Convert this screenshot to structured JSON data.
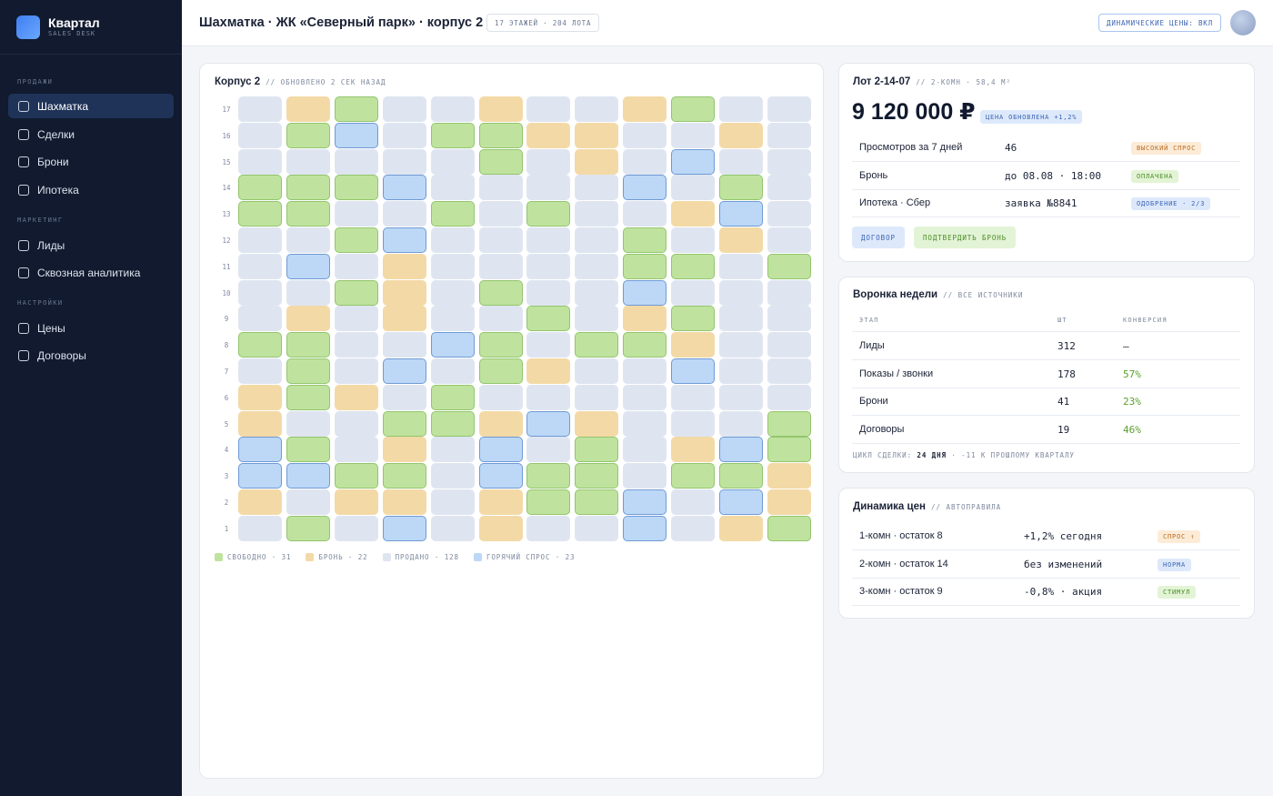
{
  "app": {
    "name": "Квартал",
    "subtitle": "SALES DESK"
  },
  "sidebar": {
    "sections": [
      {
        "label": "ПРОДАЖИ",
        "items": [
          {
            "label": "Шахматка",
            "active": true
          },
          {
            "label": "Сделки"
          },
          {
            "label": "Брони"
          },
          {
            "label": "Ипотека"
          }
        ]
      },
      {
        "label": "МАРКЕТИНГ",
        "items": [
          {
            "label": "Лиды"
          },
          {
            "label": "Сквозная аналитика"
          }
        ]
      },
      {
        "label": "НАСТРОЙКИ",
        "items": [
          {
            "label": "Цены"
          },
          {
            "label": "Договоры"
          }
        ]
      }
    ]
  },
  "header": {
    "title": "Шахматка · ЖК «Северный парк» · корпус 2",
    "stats_pill": "17 ЭТАЖЕЙ · 204 ЛОТА",
    "dynamic_pill": "ДИНАМИЧЕСКИЕ ЦЕНЫ: ВКЛ"
  },
  "board": {
    "title": "Корпус 2",
    "subtitle": "// ОБНОВЛЕНО 2 СЕК НАЗАД",
    "floors": [
      "17",
      "16",
      "15",
      "14",
      "13",
      "12",
      "11",
      "10",
      "9",
      "8",
      "7",
      "6",
      "5",
      "4",
      "3",
      "2",
      "1"
    ],
    "grid": [
      [
        "S",
        "R",
        "F",
        "S",
        "S",
        "R",
        "S",
        "S",
        "R",
        "F",
        "S",
        "S"
      ],
      [
        "S",
        "F",
        "H",
        "S",
        "F",
        "F",
        "R",
        "R",
        "S",
        "S",
        "R",
        "S"
      ],
      [
        "S",
        "S",
        "S",
        "S",
        "S",
        "F",
        "S",
        "R",
        "S",
        "H",
        "S",
        "S"
      ],
      [
        "F",
        "F",
        "F",
        "H",
        "S",
        "S",
        "S",
        "S",
        "H",
        "S",
        "F",
        "S"
      ],
      [
        "F",
        "F",
        "S",
        "S",
        "F",
        "S",
        "F",
        "S",
        "S",
        "R",
        "H",
        "S"
      ],
      [
        "S",
        "S",
        "F",
        "H",
        "S",
        "S",
        "S",
        "S",
        "F",
        "S",
        "R",
        "S"
      ],
      [
        "S",
        "H",
        "S",
        "R",
        "S",
        "S",
        "S",
        "S",
        "F",
        "F",
        "S",
        "F"
      ],
      [
        "S",
        "S",
        "F",
        "R",
        "S",
        "F",
        "S",
        "S",
        "H",
        "S",
        "S",
        "S"
      ],
      [
        "S",
        "R",
        "S",
        "R",
        "S",
        "S",
        "F",
        "S",
        "R",
        "F",
        "S",
        "S"
      ],
      [
        "F",
        "F",
        "S",
        "S",
        "H",
        "F",
        "S",
        "F",
        "F",
        "R",
        "S",
        "S"
      ],
      [
        "S",
        "F",
        "S",
        "H",
        "S",
        "F",
        "R",
        "S",
        "S",
        "H",
        "S",
        "S"
      ],
      [
        "R",
        "F",
        "R",
        "S",
        "F",
        "S",
        "S",
        "S",
        "S",
        "S",
        "S",
        "S"
      ],
      [
        "R",
        "S",
        "S",
        "F",
        "F",
        "R",
        "H",
        "R",
        "S",
        "S",
        "S",
        "F"
      ],
      [
        "H",
        "F",
        "S",
        "R",
        "S",
        "H",
        "S",
        "F",
        "S",
        "R",
        "H",
        "F"
      ],
      [
        "H",
        "H",
        "F",
        "F",
        "S",
        "H",
        "F",
        "F",
        "S",
        "F",
        "F",
        "R"
      ],
      [
        "R",
        "S",
        "R",
        "R",
        "S",
        "R",
        "F",
        "F",
        "H",
        "S",
        "H",
        "R"
      ],
      [
        "S",
        "F",
        "S",
        "H",
        "S",
        "R",
        "S",
        "S",
        "H",
        "S",
        "R",
        "F"
      ]
    ],
    "legend": [
      {
        "label": "СВОБОДНО · 31",
        "color": "#bfe39e"
      },
      {
        "label": "БРОНЬ · 22",
        "color": "#f3d9a6"
      },
      {
        "label": "ПРОДАНО · 128",
        "color": "#dfe5f0"
      },
      {
        "label": "ГОРЯЧИЙ СПРОС · 23",
        "color": "#bcd8f6"
      }
    ]
  },
  "lot": {
    "title": "Лот 2-14-07",
    "subtitle": "// 2-КОМН · 58,4 М²",
    "price": "9 120 000 ₽",
    "price_badge": "ЦЕНА ОБНОВЛЕНА +1,2%",
    "rows": [
      {
        "label": "Просмотров за 7 дней",
        "value": "46",
        "tag": "ВЫСОКИЙ СПРОС"
      },
      {
        "label": "Бронь",
        "value": "до 08.08 · 18:00",
        "tag": "ОПЛАЧЕНА"
      },
      {
        "label": "Ипотека · Сбер",
        "value": "заявка №8841",
        "tag": "ОДОБРЕНИЕ · 2/3"
      }
    ],
    "btn_contract": "ДОГОВОР",
    "btn_confirm": "ПОДТВЕРДИТЬ БРОНЬ"
  },
  "funnel": {
    "title": "Воронка недели",
    "subtitle": "// ВСЕ ИСТОЧНИКИ",
    "columns": [
      "ЭТАП",
      "ШТ",
      "КОНВЕРСИЯ"
    ],
    "rows": [
      {
        "stage": "Лиды",
        "count": "312",
        "conv": "—"
      },
      {
        "stage": "Показы / звонки",
        "count": "178",
        "conv": "57%"
      },
      {
        "stage": "Брони",
        "count": "41",
        "conv": "23%"
      },
      {
        "stage": "Договоры",
        "count": "19",
        "conv": "46%"
      }
    ],
    "footer_label": "ЦИКЛ СДЕЛКИ:",
    "footer_value": "24 ДНЯ",
    "footer_tail": "· -11 К ПРОШЛОМУ КВАРТАЛУ"
  },
  "prices": {
    "title": "Динамика цен",
    "subtitle": "// АВТОПРАВИЛА",
    "rows": [
      {
        "label": "1-комн · остаток 8",
        "value": "+1,2% сегодня",
        "tag": "СПРОС ↑"
      },
      {
        "label": "2-комн · остаток 14",
        "value": "без изменений",
        "tag": "НОРМА"
      },
      {
        "label": "3-комн · остаток 9",
        "value": "-0,8% · акция",
        "tag": "СТИМУЛ"
      }
    ]
  }
}
